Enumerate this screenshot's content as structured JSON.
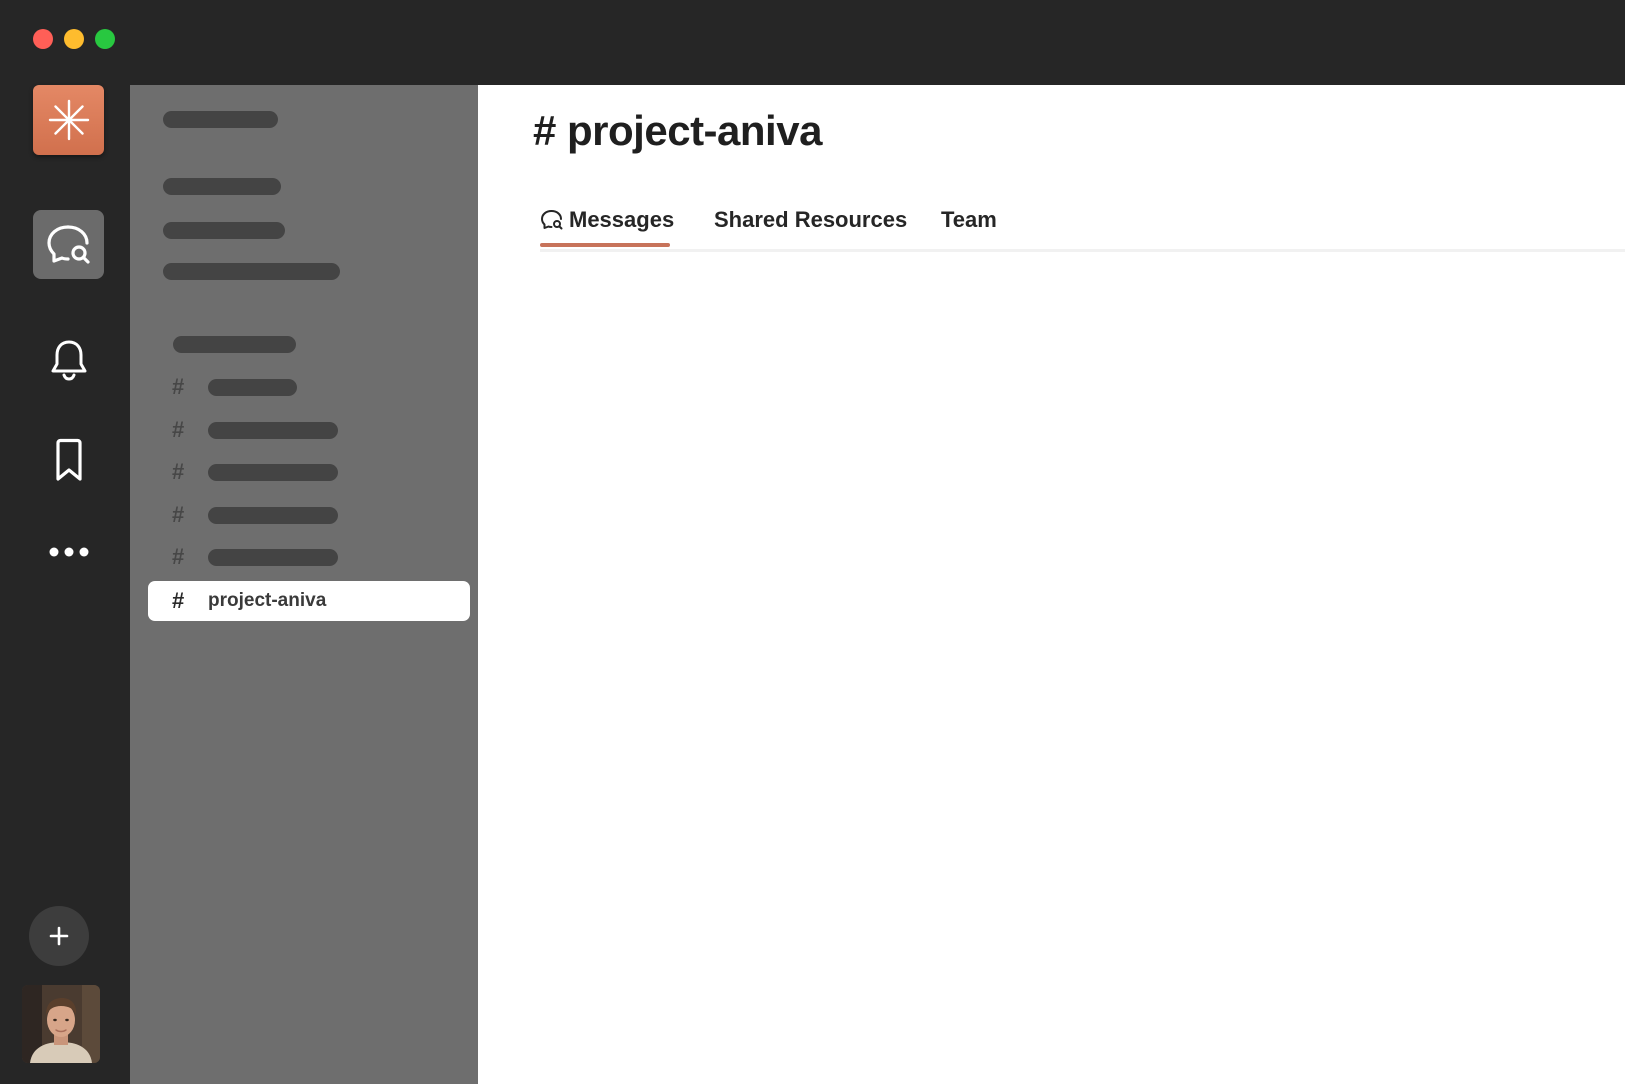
{
  "window": {
    "controls": [
      "close",
      "minimize",
      "maximize"
    ]
  },
  "rail": {
    "logo_icon": "asterisk-logo-icon",
    "items": [
      {
        "icon": "chat-search-icon",
        "active": true
      },
      {
        "icon": "bell-icon",
        "active": false
      },
      {
        "icon": "bookmark-icon",
        "active": false
      },
      {
        "icon": "more-dots-icon",
        "active": false
      }
    ],
    "add_icon": "plus-icon",
    "avatar": "user-avatar"
  },
  "sidebar": {
    "channels": [
      {
        "hash": "#"
      },
      {
        "hash": "#"
      },
      {
        "hash": "#"
      },
      {
        "hash": "#"
      },
      {
        "hash": "#"
      }
    ],
    "active_channel": {
      "hash": "#",
      "name": "project-aniva"
    }
  },
  "main": {
    "title": "# project-aniva",
    "tabs": [
      {
        "label": "Messages",
        "icon": "chat-search-icon",
        "active": true
      },
      {
        "label": "Shared Resources",
        "active": false
      },
      {
        "label": "Team",
        "active": false
      }
    ]
  },
  "colors": {
    "accent": "#c7735a",
    "rail_bg": "#262626",
    "sidebar_bg": "#6e6e6e",
    "placeholder": "#444444"
  }
}
